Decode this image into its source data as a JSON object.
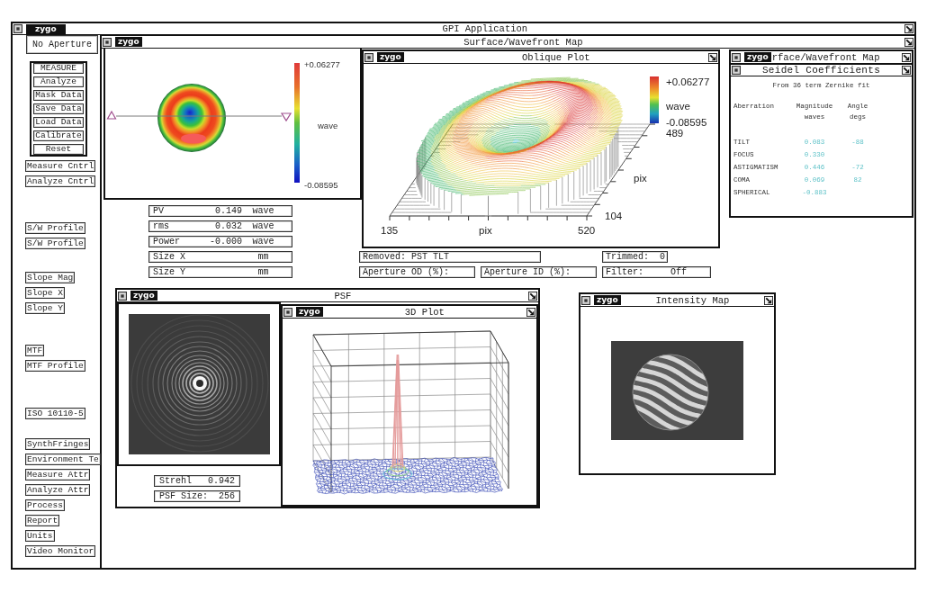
{
  "window": {
    "logo": "zygo",
    "title": "GPI Application"
  },
  "sidebar": {
    "aperture_button": "No Aperture",
    "action_buttons": [
      "MEASURE",
      "Analyze",
      "Mask Data",
      "Save Data",
      "Load Data",
      "Calibrate",
      "Reset"
    ],
    "button_groups": [
      [
        "Measure Cntrl",
        "Analyze Cntrl"
      ],
      [
        "S/W Profile",
        "S/W Profile"
      ],
      [
        "Slope Mag",
        "Slope X",
        "Slope Y"
      ],
      [
        "MTF",
        "MTF Profile"
      ],
      [
        "ISO 10110-5"
      ],
      [
        "SynthFringes",
        "Environment Te",
        "Measure Attr",
        "Analyze Attr",
        "Process",
        "Report",
        "Units",
        "Video Monitor"
      ]
    ]
  },
  "surface_window": {
    "logo": "zygo",
    "title": "Surface/Wavefront Map",
    "surface_map": {
      "scale_max": "+0.06277",
      "scale_unit": "wave",
      "scale_min": "-0.08595"
    },
    "readouts": [
      {
        "label": "PV",
        "value": "0.149",
        "unit": "wave"
      },
      {
        "label": "rms",
        "value": "0.032",
        "unit": "wave"
      },
      {
        "label": "Power",
        "value": "-0.000",
        "unit": "wave"
      },
      {
        "label": "Size X",
        "unit": "mm"
      },
      {
        "label": "Size Y",
        "unit": "mm"
      }
    ],
    "oblique_plot": {
      "logo": "zygo",
      "title": "Oblique Plot",
      "scale_max": "+0.06277",
      "scale_unit": "wave",
      "scale_min": "-0.08595",
      "y_max": "489",
      "y_label": "pix",
      "y_min": "104",
      "x_min": "135",
      "x_label": "pix",
      "x_max": "520"
    },
    "status_fields": [
      {
        "label": "Removed:",
        "value": "PST TLT"
      },
      {
        "label": "Trimmed:",
        "value": "0"
      },
      {
        "label": "Aperture OD (%):"
      },
      {
        "label": "Aperture ID (%):"
      },
      {
        "label": "Filter:",
        "value": "Off"
      }
    ],
    "seidel_window": {
      "logo": "zygo",
      "title": "rface/Wavefront Map",
      "table": {
        "title": "Seidel Coefficients",
        "caption": "From 36 term Zernike fit",
        "columns": [
          {
            "label": "Aberration"
          },
          {
            "label": "Magnitude",
            "unit": "waves"
          },
          {
            "label": "Angle",
            "unit": "degs"
          }
        ],
        "rows": [
          {
            "name": "TILT",
            "magnitude": "0.083",
            "angle": "-88"
          },
          {
            "name": "FOCUS",
            "magnitude": "0.330"
          },
          {
            "name": "ASTIGMATISM",
            "magnitude": "0.446",
            "angle": "-72"
          },
          {
            "name": "COMA",
            "magnitude": "0.069",
            "angle": "82"
          },
          {
            "name": "SPHERICAL",
            "magnitude": "-0.883"
          }
        ]
      }
    },
    "psf_window": {
      "logo": "zygo",
      "title": "PSF",
      "readouts": [
        {
          "label": "Strehl",
          "value": "0.942"
        },
        {
          "label": "PSF Size:",
          "value": "256"
        }
      ],
      "plot_3d": {
        "logo": "zygo",
        "title": "3D Plot"
      }
    },
    "intensity_window": {
      "logo": "zygo",
      "title": "Intensity Map"
    }
  }
}
